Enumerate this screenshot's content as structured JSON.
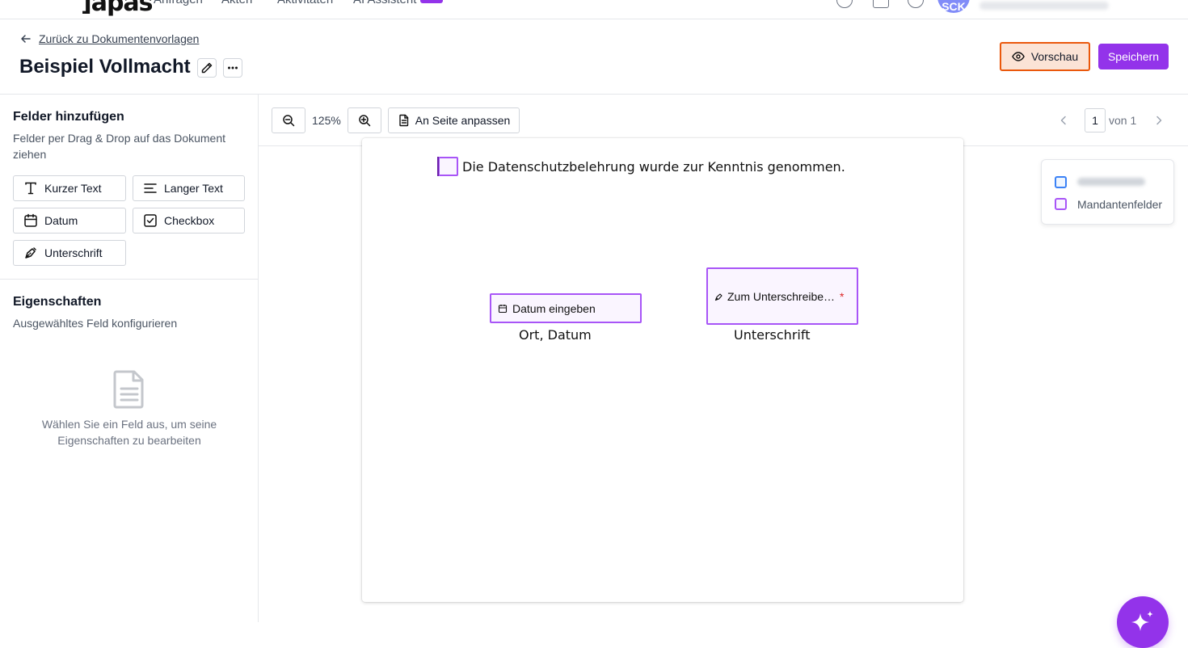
{
  "nav": {
    "logo": "]apas",
    "links": [
      "Anfragen",
      "Akten",
      "Aktivitäten",
      "AI Assistent"
    ],
    "avatar_initials": "SCK"
  },
  "header": {
    "back_label": "Zurück zu Dokumentenvorlagen",
    "title": "Beispiel Vollmacht",
    "preview_label": "Vorschau",
    "save_label": "Speichern"
  },
  "sidebar": {
    "fields_title": "Felder hinzufügen",
    "fields_desc": "Felder per Drag & Drop auf das Dokument ziehen",
    "field_types": [
      {
        "label": "Kurzer Text",
        "icon": "text-icon"
      },
      {
        "label": "Langer Text",
        "icon": "align-left-icon"
      },
      {
        "label": "Datum",
        "icon": "calendar-icon"
      },
      {
        "label": "Checkbox",
        "icon": "checkbox-icon"
      },
      {
        "label": "Unterschrift",
        "icon": "pen-tool-icon"
      }
    ],
    "props_title": "Eigenschaften",
    "props_desc": "Ausgewähltes Feld konfigurieren",
    "empty_text": "Wählen Sie ein Feld aus, um seine Eigenschaften zu bearbeiten"
  },
  "toolbar": {
    "zoom": "125%",
    "fit_label": "An Seite anpassen",
    "page_current": "1",
    "page_total_label": "von 1"
  },
  "document": {
    "checkbox_text": "Die Datenschutzbelehrung wurde zur Kenntnis genommen.",
    "date_placeholder": "Datum eingeben",
    "date_caption": "Ort, Datum",
    "signature_placeholder": "Zum Unterschreibe…",
    "signature_required": "*",
    "signature_caption": "Unterschrift"
  },
  "legend": {
    "items": [
      {
        "label": "",
        "color": "#3b82f6"
      },
      {
        "label": "Mandantenfelder",
        "color": "#a855f7"
      }
    ]
  },
  "colors": {
    "accent": "#9333ea",
    "preview_border": "#ea580c",
    "preview_bg": "#fbe3d6"
  }
}
